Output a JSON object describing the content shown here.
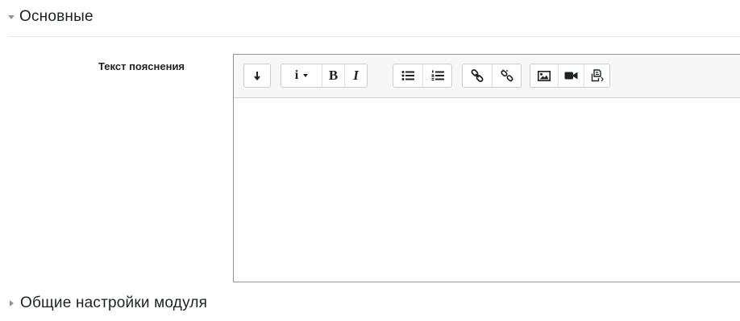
{
  "sections": {
    "general": {
      "title": "Основные",
      "state": "expanded"
    },
    "module": {
      "title": "Общие настройки модуля",
      "state": "collapsed"
    }
  },
  "field": {
    "label": "Текст пояснения",
    "value": ""
  },
  "toolbar": {
    "groups": [
      [
        "show-more-icon"
      ],
      [
        "info-style-icon",
        "bold-icon",
        "italic-icon"
      ],
      [
        "unordered-list-icon",
        "ordered-list-icon"
      ],
      [
        "link-icon",
        "unlink-icon"
      ],
      [
        "image-icon",
        "video-icon",
        "manage-files-icon"
      ]
    ],
    "info_label": "i",
    "bold_label": "B",
    "italic_label": "I"
  },
  "colors": {
    "section_caret": "#8f959a",
    "text": "#1d2125",
    "editor_border": "#8f959a",
    "toolbar_bg": "#f7f7f7"
  }
}
